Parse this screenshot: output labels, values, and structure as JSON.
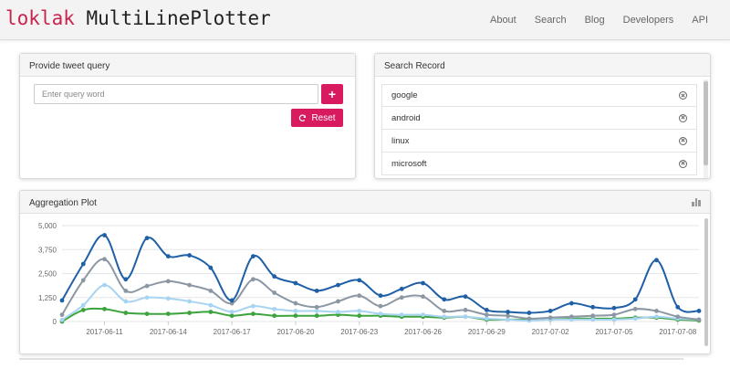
{
  "navbar": {
    "brand_part1": "loklak",
    "brand_part2": "MultiLinePlotter",
    "links": [
      "About",
      "Search",
      "Blog",
      "Developers",
      "API"
    ]
  },
  "query_panel": {
    "title": "Provide tweet query",
    "input_placeholder": "Enter query word",
    "input_value": "",
    "add_icon": "plus-icon",
    "reset_icon": "refresh-icon",
    "reset_label": "Reset"
  },
  "record_panel": {
    "title": "Search Record",
    "items": [
      "google",
      "android",
      "linux",
      "microsoft"
    ],
    "remove_icon": "circle-x-icon"
  },
  "plot_panel": {
    "title": "Aggregation Plot",
    "icon": "bar-chart-icon"
  },
  "chart_data": {
    "type": "line",
    "x": [
      "2017-06-09",
      "2017-06-10",
      "2017-06-11",
      "2017-06-12",
      "2017-06-13",
      "2017-06-14",
      "2017-06-15",
      "2017-06-16",
      "2017-06-17",
      "2017-06-18",
      "2017-06-19",
      "2017-06-20",
      "2017-06-21",
      "2017-06-22",
      "2017-06-23",
      "2017-06-24",
      "2017-06-25",
      "2017-06-26",
      "2017-06-27",
      "2017-06-28",
      "2017-06-29",
      "2017-06-30",
      "2017-07-01",
      "2017-07-02",
      "2017-07-03",
      "2017-07-04",
      "2017-07-05",
      "2017-07-06",
      "2017-07-07",
      "2017-07-08",
      "2017-07-09"
    ],
    "x_tick_labels": [
      "2017-06-11",
      "2017-06-14",
      "2017-06-17",
      "2017-06-20",
      "2017-06-23",
      "2017-06-26",
      "2017-06-29",
      "2017-07-02",
      "2017-07-05",
      "2017-07-08"
    ],
    "y_tick_labels": [
      "0",
      "1,250",
      "2,500",
      "3,750",
      "5,000"
    ],
    "ylim": [
      0,
      5000
    ],
    "grid": true,
    "series": [
      {
        "color": "#1f5fa6",
        "values": [
          1100,
          3000,
          4500,
          2200,
          4350,
          3400,
          3450,
          2800,
          1100,
          3400,
          2350,
          2000,
          1600,
          1900,
          2150,
          1350,
          1700,
          2000,
          1150,
          1300,
          600,
          500,
          450,
          550,
          950,
          750,
          700,
          1150,
          3200,
          750,
          550
        ]
      },
      {
        "color": "#8c97a4",
        "values": [
          350,
          2150,
          3250,
          1600,
          1850,
          2100,
          1900,
          1600,
          950,
          2200,
          1500,
          950,
          750,
          1050,
          1350,
          800,
          1250,
          1300,
          550,
          600,
          350,
          300,
          150,
          200,
          250,
          300,
          350,
          650,
          550,
          250,
          100
        ]
      },
      {
        "color": "#a8d4f2",
        "values": [
          80,
          850,
          1900,
          1050,
          1250,
          1200,
          1050,
          850,
          500,
          800,
          650,
          550,
          550,
          500,
          550,
          400,
          350,
          350,
          250,
          250,
          150,
          100,
          50,
          100,
          100,
          100,
          100,
          150,
          250,
          150,
          100
        ]
      },
      {
        "color": "#3da33d",
        "values": [
          0,
          600,
          650,
          450,
          400,
          400,
          450,
          500,
          300,
          400,
          300,
          300,
          300,
          350,
          300,
          300,
          250,
          250,
          200,
          250,
          100,
          100,
          100,
          100,
          150,
          150,
          150,
          200,
          200,
          100,
          50
        ]
      }
    ]
  }
}
